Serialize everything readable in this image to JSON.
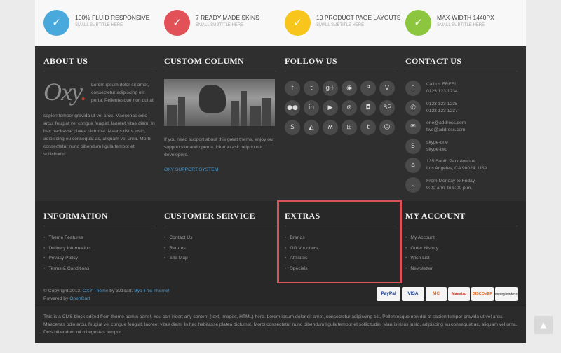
{
  "features": [
    {
      "title": "100% FLUID RESPONSIVE",
      "subtitle": "SMALL SUBTITLE HERE",
      "color": "#4aa9dc",
      "icon": "checkmark-icon"
    },
    {
      "title": "7 READY-MADE SKINS",
      "subtitle": "SMALL SUBTITLE HERE",
      "color": "#e25058",
      "icon": "checkmark-icon"
    },
    {
      "title": "10 PRODUCT PAGE LAYOUTS",
      "subtitle": "SMALL SUBTITLE HERE",
      "color": "#f7c51b",
      "icon": "checkmark-icon"
    },
    {
      "title": "MAX-WIDTH 1440PX",
      "subtitle": "SMALL SUBTITLE HERE",
      "color": "#8cc63e",
      "icon": "checkmark-icon"
    }
  ],
  "about": {
    "title": "ABOUT US",
    "logo_text": "Oxy",
    "logo_dot": ".",
    "text_side": "Lorem ipsum dolor sit amet, consectetur adipiscing elit porta. Pellentesque non dui at",
    "text_full": "sapien tempor gravida ut vel arcu. Maecenas odio arcu, feugiat vel congue feugiat, laoreet vitae diam. In hac habitasse platea dictumst. Mauris risus justo, adipiscing eu consequat ac, aliquam vel urna. Morbi consectetur nunc bibendum ligula tempor et sollicitudin."
  },
  "custom": {
    "title": "CUSTOM COLUMN",
    "text": "If you need support about this great theme, enjoy our support site and open a ticket to ask help to our developers.",
    "link": "OXY SUPPORT SYSTEM"
  },
  "follow": {
    "title": "FOLLOW US",
    "icons": [
      {
        "name": "facebook-icon",
        "glyph": "f"
      },
      {
        "name": "twitter-icon",
        "glyph": "t"
      },
      {
        "name": "google-plus-icon",
        "glyph": "g+"
      },
      {
        "name": "rss-icon",
        "glyph": "◉"
      },
      {
        "name": "pinterest-icon",
        "glyph": "P"
      },
      {
        "name": "vimeo-icon",
        "glyph": "V"
      },
      {
        "name": "flickr-icon",
        "glyph": "●●"
      },
      {
        "name": "linkedin-icon",
        "glyph": "in"
      },
      {
        "name": "youtube-icon",
        "glyph": "▶"
      },
      {
        "name": "dribbble-icon",
        "glyph": "⊛"
      },
      {
        "name": "instagram-icon",
        "glyph": "◘"
      },
      {
        "name": "behance-icon",
        "glyph": "Bē"
      },
      {
        "name": "skype-icon",
        "glyph": "S"
      },
      {
        "name": "foursquare-icon",
        "glyph": "◭"
      },
      {
        "name": "myspace-icon",
        "glyph": "ʍ"
      },
      {
        "name": "windows-icon",
        "glyph": "⊞"
      },
      {
        "name": "tumblr-icon",
        "glyph": "t"
      },
      {
        "name": "reddit-icon",
        "glyph": "☺"
      }
    ]
  },
  "contact": {
    "title": "CONTACT US",
    "items": [
      {
        "icon": "mobile-phone-icon",
        "glyph": "▯",
        "lines": [
          "Call us FREE!",
          "0123 123 1234"
        ]
      },
      {
        "icon": "phone-icon",
        "glyph": "✆",
        "lines": [
          "0123 123 1235",
          "0123 123 1237"
        ]
      },
      {
        "icon": "envelope-icon",
        "glyph": "✉",
        "lines": [
          "one@address.com",
          "two@address.com"
        ]
      },
      {
        "icon": "skype-icon",
        "glyph": "S",
        "lines": [
          "skype-one",
          "skype-two"
        ]
      },
      {
        "icon": "home-icon",
        "glyph": "⌂",
        "lines": [
          "135 South Park Avenue",
          "Los Angeles, CA 90024. USA"
        ]
      },
      {
        "icon": "clock-icon",
        "glyph": "⌄",
        "lines": [
          "From Monday to Friday",
          "9:00 a.m. to 5:00 p.m."
        ]
      }
    ]
  },
  "information": {
    "title": "INFORMATION",
    "items": [
      "Theme Features",
      "Delivery Information",
      "Privacy Policy",
      "Terms & Conditions"
    ]
  },
  "customer_service": {
    "title": "CUSTOMER SERVICE",
    "items": [
      "Contact Us",
      "Returns",
      "Site Map"
    ]
  },
  "extras": {
    "title": "EXTRAS",
    "items": [
      "Brands",
      "Gift Vouchers",
      "Affiliates",
      "Specials"
    ]
  },
  "account": {
    "title": "MY ACCOUNT",
    "items": [
      "My Account",
      "Order History",
      "Wish List",
      "Newsletter"
    ]
  },
  "copyright": {
    "prefix": "© Copyright 2013.",
    "theme_link": "OXY Theme",
    "by": "by 321cart.",
    "buy_link": "Bye This Theme!",
    "powered": "Powered by",
    "opencart": "OpenCart"
  },
  "payments": [
    "PayPal",
    "VISA",
    "MC",
    "Maestro",
    "DISCOVER",
    "Moneybookers"
  ],
  "cms_text": "This is a CMS block edited from theme admin panel. You can insert any content (text, images, HTML) here. Lorem ipsum dolor sit amet, consectetur adipiscing elit. Pellentesque non dui at sapien tempor gravida ut vel arcu. Maecenas odio arcu, feugiat vel congue feugiat, laoreet vitae diam. In hac habitasse platea dictumst. Morbi consectetur nunc bibendum ligula tempor et sollicitudin. Mauris risus justo, adipiscing eu consequat ac, aliquam vel urna. Duis bibendum mi mi egestas tempor.",
  "scroll_top": "▲"
}
